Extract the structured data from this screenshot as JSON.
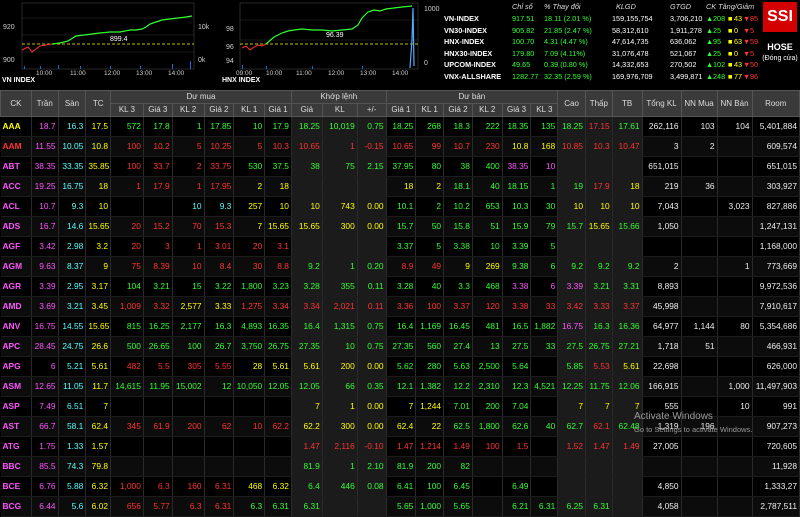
{
  "vn_chart": {
    "title": "VN INDEX",
    "left_labels": [
      "920",
      "900"
    ],
    "right_labels": [
      "10k",
      "0k"
    ],
    "value_label": "899.4",
    "time_labels": [
      "10:00",
      "11:00",
      "12:00",
      "13:00",
      "14:00"
    ]
  },
  "hnx_chart": {
    "title": "HNX INDEX",
    "left_labels": [
      "98",
      "96",
      "94"
    ],
    "right_labels": [
      "1000",
      "0"
    ],
    "value_label": "96.39",
    "time_labels": [
      "09:00",
      "10:00",
      "11:00",
      "12:00",
      "13:00",
      "14:00"
    ]
  },
  "index_header": {
    "c1": "Chỉ số",
    "c2": "% Thay đổi",
    "c3": "KLGD",
    "c4": "GTGD",
    "c5": "CK Tăng/Giảm"
  },
  "indices": [
    {
      "name": "VN-INDEX",
      "value": "917.51",
      "change": "18.11 (2.01 %)",
      "vol": "159,155,754",
      "val": "3,706,210",
      "up": "208",
      "ref": "43",
      "down": "85"
    },
    {
      "name": "VN30-INDEX",
      "value": "905.82",
      "change": "21.85 (2.47 %)",
      "vol": "58,312,610",
      "val": "1,911,278",
      "up": "25",
      "ref": "0",
      "down": "5"
    },
    {
      "name": "HNX-INDEX",
      "value": "100.70",
      "change": "4.31 (4.47 %)",
      "vol": "47,614,735",
      "val": "636,062",
      "up": "95",
      "ref": "63",
      "down": "59"
    },
    {
      "name": "HNX30-INDEX",
      "value": "179.80",
      "change": "7.09 (4.11%)",
      "vol": "31,076,478",
      "val": "521,067",
      "up": "25",
      "ref": "0",
      "down": "5"
    },
    {
      "name": "UPCOM-INDEX",
      "value": "49.65",
      "change": "0.39 (0.80 %)",
      "vol": "14,332,653",
      "val": "270,502",
      "up": "102",
      "ref": "43",
      "down": "50"
    },
    {
      "name": "VNX-ALLSHARE",
      "value": "1282.77",
      "change": "32.35 (2.59 %)",
      "vol": "169,976,709",
      "val": "3,499,871",
      "up": "248",
      "ref": "77",
      "down": "96"
    }
  ],
  "logo": {
    "text": "SSI",
    "exchange": "HOSE",
    "status": "(Đóng cửa)"
  },
  "table_header_groups": {
    "buy": "Dư mua",
    "match": "Khớp lệnh",
    "sell": "Dư bán"
  },
  "columns": [
    "CK",
    "Trần",
    "Sàn",
    "TC",
    "KL 3",
    "Giá 3",
    "KL 2",
    "Giá 2",
    "KL 1",
    "Giá 1",
    "Giá",
    "KL",
    "+/-",
    "Giá 1",
    "KL 1",
    "Giá 2",
    "KL 2",
    "Giá 3",
    "KL 3",
    "Cao",
    "Thấp",
    "TB",
    "Tổng KL",
    "NN Mua",
    "NN Bán",
    "Room"
  ],
  "rows": [
    {
      "v": [
        "AAA",
        "18.7",
        "16.3",
        "17.5",
        "572",
        "17.8",
        "1",
        "17.85",
        "10",
        "17.9",
        "18.25",
        "10,019",
        "0.75",
        "18.25",
        "268",
        "18.3",
        "222",
        "18.35",
        "135",
        "18.25",
        "17.15",
        "17.61",
        "262,116",
        "103",
        "104",
        "5,401,884"
      ],
      "c": [
        "y",
        "f",
        "c",
        "y",
        "g",
        "g",
        "g",
        "g",
        "g",
        "g",
        "g",
        "g",
        "g",
        "g",
        "g",
        "g",
        "g",
        "g",
        "g",
        "g",
        "r",
        "g",
        "w",
        "w",
        "w",
        "w"
      ]
    },
    {
      "v": [
        "AAM",
        "11.55",
        "10.05",
        "10.8",
        "100",
        "10.2",
        "5",
        "10.25",
        "5",
        "10.3",
        "10.65",
        "1",
        "-0.15",
        "10.65",
        "99",
        "10.7",
        "230",
        "10.8",
        "168",
        "10.85",
        "10.3",
        "10.47",
        "3",
        "2",
        "",
        "609,574"
      ],
      "c": [
        "r",
        "f",
        "c",
        "y",
        "r",
        "r",
        "r",
        "r",
        "r",
        "r",
        "r",
        "r",
        "r",
        "r",
        "r",
        "r",
        "r",
        "y",
        "y",
        "r",
        "r",
        "r",
        "w",
        "w",
        "w",
        "w"
      ]
    },
    {
      "v": [
        "ABT",
        "38.35",
        "33.35",
        "35.85",
        "100",
        "33.7",
        "2",
        "33.75",
        "530",
        "37.5",
        "38",
        "75",
        "2.15",
        "37.95",
        "80",
        "38",
        "400",
        "38.35",
        "10",
        "",
        "",
        "",
        "651,015",
        "",
        "",
        "651,015"
      ],
      "c": [
        "f",
        "f",
        "c",
        "y",
        "r",
        "r",
        "r",
        "r",
        "g",
        "g",
        "g",
        "g",
        "g",
        "g",
        "g",
        "g",
        "g",
        "f",
        "f",
        "w",
        "w",
        "w",
        "w",
        "w",
        "w",
        "w"
      ]
    },
    {
      "v": [
        "ACC",
        "19.25",
        "16.75",
        "18",
        "1",
        "17.9",
        "1",
        "17.95",
        "2",
        "18",
        "",
        "",
        "",
        "18",
        "2",
        "18.1",
        "40",
        "18.15",
        "1",
        "19",
        "17.9",
        "18",
        "219",
        "36",
        "",
        "303,927"
      ],
      "c": [
        "f",
        "f",
        "c",
        "y",
        "r",
        "r",
        "r",
        "r",
        "y",
        "y",
        "y",
        "y",
        "y",
        "y",
        "y",
        "g",
        "g",
        "g",
        "g",
        "g",
        "r",
        "y",
        "w",
        "w",
        "w",
        "w"
      ]
    },
    {
      "v": [
        "ACL",
        "10.7",
        "9.3",
        "10",
        "",
        "",
        "10",
        "9.3",
        "257",
        "10",
        "10",
        "743",
        "0.00",
        "10.1",
        "2",
        "10.2",
        "653",
        "10.3",
        "30",
        "10",
        "10",
        "10",
        "7,043",
        "",
        "3,023",
        "827,886"
      ],
      "c": [
        "f",
        "f",
        "c",
        "y",
        "r",
        "r",
        "c",
        "c",
        "y",
        "y",
        "y",
        "y",
        "y",
        "g",
        "g",
        "g",
        "g",
        "g",
        "g",
        "y",
        "y",
        "y",
        "w",
        "w",
        "w",
        "w"
      ]
    },
    {
      "v": [
        "ADS",
        "16.7",
        "14.6",
        "15.65",
        "20",
        "15.2",
        "70",
        "15.3",
        "7",
        "15.65",
        "15.65",
        "300",
        "0.00",
        "15.7",
        "50",
        "15.8",
        "51",
        "15.9",
        "79",
        "15.7",
        "15.65",
        "15.66",
        "1,050",
        "",
        "",
        "1,247,131"
      ],
      "c": [
        "f",
        "f",
        "c",
        "y",
        "r",
        "r",
        "r",
        "r",
        "y",
        "y",
        "y",
        "y",
        "y",
        "g",
        "g",
        "g",
        "g",
        "g",
        "g",
        "g",
        "y",
        "g",
        "w",
        "w",
        "w",
        "w"
      ]
    },
    {
      "v": [
        "AGF",
        "3.42",
        "2.98",
        "3.2",
        "20",
        "3",
        "1",
        "3.01",
        "20",
        "3.1",
        "",
        "",
        "",
        "3.37",
        "5",
        "3.38",
        "10",
        "3.39",
        "5",
        "",
        "",
        "",
        "",
        "",
        "",
        "1,168,000"
      ],
      "c": [
        "f",
        "f",
        "c",
        "y",
        "r",
        "r",
        "r",
        "r",
        "r",
        "r",
        "w",
        "w",
        "w",
        "g",
        "g",
        "g",
        "g",
        "g",
        "g",
        "w",
        "w",
        "w",
        "w",
        "w",
        "w",
        "w"
      ]
    },
    {
      "v": [
        "AGM",
        "9.63",
        "8.37",
        "9",
        "75",
        "8.39",
        "10",
        "8.4",
        "30",
        "8.8",
        "9.2",
        "1",
        "0.20",
        "8.9",
        "49",
        "9",
        "269",
        "9.38",
        "6",
        "9.2",
        "9.2",
        "9.2",
        "2",
        "",
        "1",
        "773,669"
      ],
      "c": [
        "f",
        "f",
        "c",
        "y",
        "r",
        "r",
        "r",
        "r",
        "r",
        "r",
        "g",
        "g",
        "g",
        "r",
        "r",
        "y",
        "y",
        "g",
        "g",
        "g",
        "g",
        "g",
        "w",
        "w",
        "w",
        "w"
      ]
    },
    {
      "v": [
        "AGR",
        "3.39",
        "2.95",
        "3.17",
        "104",
        "3.21",
        "15",
        "3.22",
        "1,800",
        "3.23",
        "3.28",
        "355",
        "0.11",
        "3.28",
        "40",
        "3.3",
        "468",
        "3.38",
        "6",
        "3.39",
        "3.21",
        "3.31",
        "8,893",
        "",
        "",
        "9,972,536"
      ],
      "c": [
        "f",
        "f",
        "c",
        "y",
        "g",
        "g",
        "g",
        "g",
        "g",
        "g",
        "g",
        "g",
        "g",
        "g",
        "g",
        "g",
        "g",
        "f",
        "f",
        "f",
        "g",
        "g",
        "w",
        "w",
        "w",
        "w"
      ]
    },
    {
      "v": [
        "AMD",
        "3.69",
        "3.21",
        "3.45",
        "1,009",
        "3.32",
        "2,577",
        "3.33",
        "1,275",
        "3.34",
        "3.34",
        "2,021",
        "0.11",
        "3.36",
        "100",
        "3.37",
        "120",
        "3.38",
        "33",
        "3.42",
        "3.33",
        "3.37",
        "45,998",
        "",
        "",
        "7,910,617"
      ],
      "c": [
        "f",
        "f",
        "c",
        "y",
        "r",
        "r",
        "y",
        "y",
        "r",
        "r",
        "r",
        "r",
        "r",
        "r",
        "r",
        "r",
        "r",
        "r",
        "r",
        "r",
        "r",
        "r",
        "w",
        "w",
        "w",
        "w"
      ]
    },
    {
      "v": [
        "ANV",
        "16.75",
        "14.55",
        "15.65",
        "815",
        "16.25",
        "2,177",
        "16.3",
        "4,893",
        "16.35",
        "16.4",
        "1,315",
        "0.75",
        "16.4",
        "1,169",
        "16.45",
        "481",
        "16.5",
        "1,882",
        "16.75",
        "16.3",
        "16.36",
        "64,977",
        "1,144",
        "80",
        "5,354,686"
      ],
      "c": [
        "f",
        "f",
        "c",
        "y",
        "g",
        "g",
        "g",
        "g",
        "g",
        "g",
        "g",
        "g",
        "g",
        "g",
        "g",
        "g",
        "g",
        "g",
        "g",
        "f",
        "g",
        "g",
        "w",
        "w",
        "w",
        "w"
      ]
    },
    {
      "v": [
        "APC",
        "28.45",
        "24.75",
        "26.6",
        "500",
        "26.65",
        "100",
        "26.7",
        "3,750",
        "26.75",
        "27.35",
        "10",
        "0.75",
        "27.35",
        "560",
        "27.4",
        "13",
        "27.5",
        "33",
        "27.5",
        "26.75",
        "27.21",
        "1,718",
        "51",
        "",
        "466,931"
      ],
      "c": [
        "f",
        "f",
        "c",
        "y",
        "g",
        "g",
        "g",
        "g",
        "g",
        "g",
        "g",
        "g",
        "g",
        "g",
        "g",
        "g",
        "g",
        "g",
        "g",
        "g",
        "g",
        "g",
        "w",
        "w",
        "w",
        "w"
      ]
    },
    {
      "v": [
        "APG",
        "6",
        "5.21",
        "5.61",
        "482",
        "5.5",
        "305",
        "5.55",
        "28",
        "5.61",
        "5.61",
        "200",
        "0.00",
        "5.62",
        "280",
        "5.63",
        "2,500",
        "5.64",
        "",
        "5.85",
        "5.53",
        "5.61",
        "22,698",
        "",
        "",
        "626,000"
      ],
      "c": [
        "f",
        "f",
        "c",
        "y",
        "r",
        "r",
        "r",
        "r",
        "y",
        "y",
        "y",
        "y",
        "y",
        "g",
        "g",
        "g",
        "g",
        "g",
        "g",
        "g",
        "r",
        "y",
        "w",
        "w",
        "w",
        "w"
      ]
    },
    {
      "v": [
        "ASM",
        "12.65",
        "11.05",
        "11.7",
        "14,615",
        "11.95",
        "15,002",
        "12",
        "10,050",
        "12.05",
        "12.05",
        "66",
        "0.35",
        "12.1",
        "1,382",
        "12.2",
        "2,310",
        "12.3",
        "4,521",
        "12.25",
        "11.75",
        "12.06",
        "166,915",
        "",
        "1,000",
        "11,497,903"
      ],
      "c": [
        "f",
        "f",
        "c",
        "y",
        "g",
        "g",
        "g",
        "g",
        "g",
        "g",
        "g",
        "g",
        "g",
        "g",
        "g",
        "g",
        "g",
        "g",
        "g",
        "g",
        "g",
        "g",
        "w",
        "w",
        "w",
        "w"
      ]
    },
    {
      "v": [
        "ASP",
        "7.49",
        "6.51",
        "7",
        "",
        "",
        "",
        "",
        "",
        "",
        "7",
        "1",
        "0.00",
        "7",
        "1,244",
        "7.01",
        "200",
        "7.04",
        "",
        "7",
        "7",
        "7",
        "555",
        "",
        "10",
        "991"
      ],
      "c": [
        "f",
        "f",
        "c",
        "y",
        "w",
        "w",
        "w",
        "w",
        "w",
        "w",
        "y",
        "y",
        "y",
        "y",
        "y",
        "g",
        "g",
        "g",
        "g",
        "y",
        "y",
        "y",
        "w",
        "w",
        "w",
        "w"
      ]
    },
    {
      "v": [
        "AST",
        "66.7",
        "58.1",
        "62.4",
        "345",
        "61.9",
        "200",
        "62",
        "10",
        "62.2",
        "62.2",
        "300",
        "0.00",
        "62.4",
        "22",
        "62.5",
        "1,800",
        "62.6",
        "40",
        "62.7",
        "62.1",
        "62.48",
        "1,319",
        "196",
        "",
        "907,273"
      ],
      "c": [
        "f",
        "f",
        "c",
        "y",
        "r",
        "r",
        "r",
        "r",
        "r",
        "r",
        "y",
        "y",
        "y",
        "y",
        "y",
        "g",
        "g",
        "g",
        "g",
        "g",
        "r",
        "g",
        "w",
        "w",
        "w",
        "w"
      ]
    },
    {
      "v": [
        "ATG",
        "1.75",
        "1.33",
        "1.57",
        "",
        "",
        "",
        "",
        "",
        "",
        "1.47",
        "2,116",
        "-0.10",
        "1.47",
        "1,214",
        "1.49",
        "100",
        "1.5",
        "",
        "1.52",
        "1.47",
        "1.49",
        "27,005",
        "",
        "",
        "720,605"
      ],
      "c": [
        "f",
        "f",
        "c",
        "y",
        "w",
        "w",
        "w",
        "w",
        "w",
        "w",
        "r",
        "r",
        "r",
        "r",
        "r",
        "r",
        "r",
        "r",
        "r",
        "r",
        "r",
        "r",
        "w",
        "w",
        "w",
        "w"
      ]
    },
    {
      "v": [
        "BBC",
        "85.5",
        "74.3",
        "79.8",
        "",
        "",
        "",
        "",
        "",
        "",
        "81.9",
        "1",
        "2.10",
        "81.9",
        "200",
        "82",
        "",
        "",
        "",
        "",
        "",
        "",
        "",
        "",
        "",
        "11,928"
      ],
      "c": [
        "f",
        "f",
        "c",
        "y",
        "w",
        "w",
        "w",
        "w",
        "w",
        "w",
        "g",
        "g",
        "g",
        "g",
        "g",
        "g",
        "g",
        "w",
        "w",
        "w",
        "w",
        "w",
        "w",
        "w",
        "w",
        "w"
      ]
    },
    {
      "v": [
        "BCE",
        "6.76",
        "5.88",
        "6.32",
        "1,000",
        "6.3",
        "160",
        "6.31",
        "468",
        "6.32",
        "6.4",
        "446",
        "0.08",
        "6.41",
        "100",
        "6.45",
        "",
        "6.49",
        "",
        "",
        "",
        "",
        "4,850",
        "",
        "",
        "1,333,27"
      ],
      "c": [
        "f",
        "f",
        "c",
        "y",
        "r",
        "r",
        "r",
        "r",
        "y",
        "y",
        "g",
        "g",
        "g",
        "g",
        "g",
        "g",
        "g",
        "g",
        "g",
        "w",
        "w",
        "w",
        "w",
        "w",
        "w",
        "w"
      ]
    },
    {
      "v": [
        "BCG",
        "6.44",
        "5.6",
        "6.02",
        "656",
        "5.77",
        "6.3",
        "6.31",
        "6.3",
        "6.31",
        "6.31",
        "",
        "",
        "5.65",
        "1,000",
        "5.65",
        "",
        "6.21",
        "6.31",
        "6.25",
        "6.31",
        "",
        "4,058",
        "",
        "",
        "2,787,511"
      ],
      "c": [
        "f",
        "f",
        "c",
        "y",
        "r",
        "r",
        "r",
        "r",
        "g",
        "g",
        "g",
        "g",
        "g",
        "g",
        "g",
        "g",
        "g",
        "g",
        "g",
        "g",
        "g",
        "g",
        "w",
        "w",
        "w",
        "w"
      ]
    }
  ],
  "watermark": {
    "line1": "Activate Windows",
    "line2": "Go to Settings to activate Windows."
  }
}
